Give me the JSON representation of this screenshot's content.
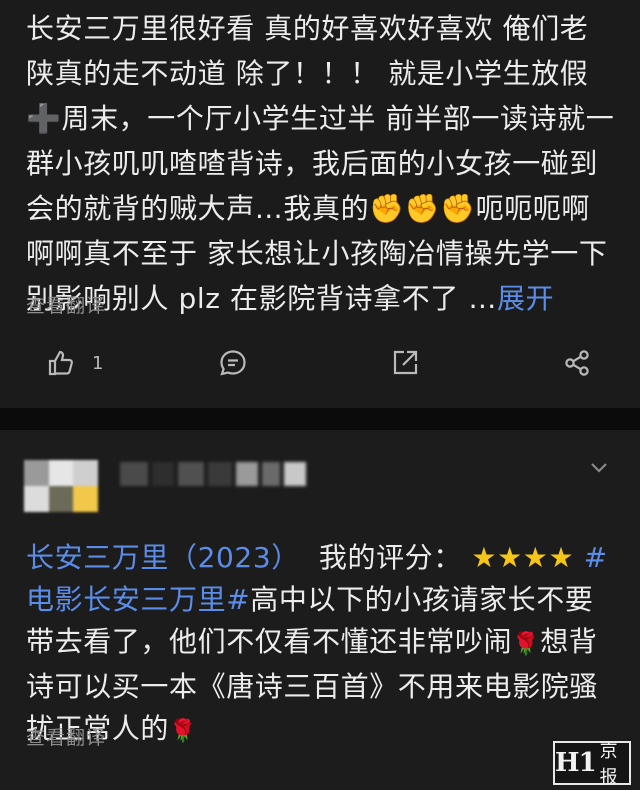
{
  "post": {
    "text": "长安三万里很好看 真的好喜欢好喜欢 俺们老陕真的走不动道 除了！！！ 就是小学生放假➕周末，一个厅小学生过半 前半部一读诗就一群小孩叽叽喳喳背诗，我后面的小女孩一碰到会的就背的贼大声…我真的",
    "fists": "✊✊✊",
    "text_after": "呃呃呃啊啊啊真不至于 家长想让小孩陶冶情操先学一下别影响别人 plz 在影院背诗拿不了 …",
    "more_label": "展开",
    "translate_label": "查看翻译",
    "actions": {
      "like_icon": "thumbs-up-icon",
      "like_count": "1",
      "comment_icon": "comment-icon",
      "share_out_icon": "external-share-icon",
      "share_icon": "share-nodes-icon"
    }
  },
  "review": {
    "movie_title": "长安三万里（2023）",
    "rating_label": "我的评分：",
    "stars": "★★★★",
    "hashtag": "#电影长安三万里#",
    "text_1": "高中以下的小孩请家长不要带去看了，他们不仅看不懂还非常吵闹",
    "rose_1": "🌹",
    "text_2": "想背诗可以买一本《唐诗三百首》不用来电影院骚扰正常人的",
    "rose_2": "🌹",
    "translate_label": "查看翻译",
    "menu_icon": "chevron-down-icon"
  },
  "watermark": {
    "part_a": "H1",
    "part_b": "京报"
  },
  "colors": {
    "link": "#5b8de8",
    "star": "#f5c518",
    "background": "#1b1b1b"
  }
}
